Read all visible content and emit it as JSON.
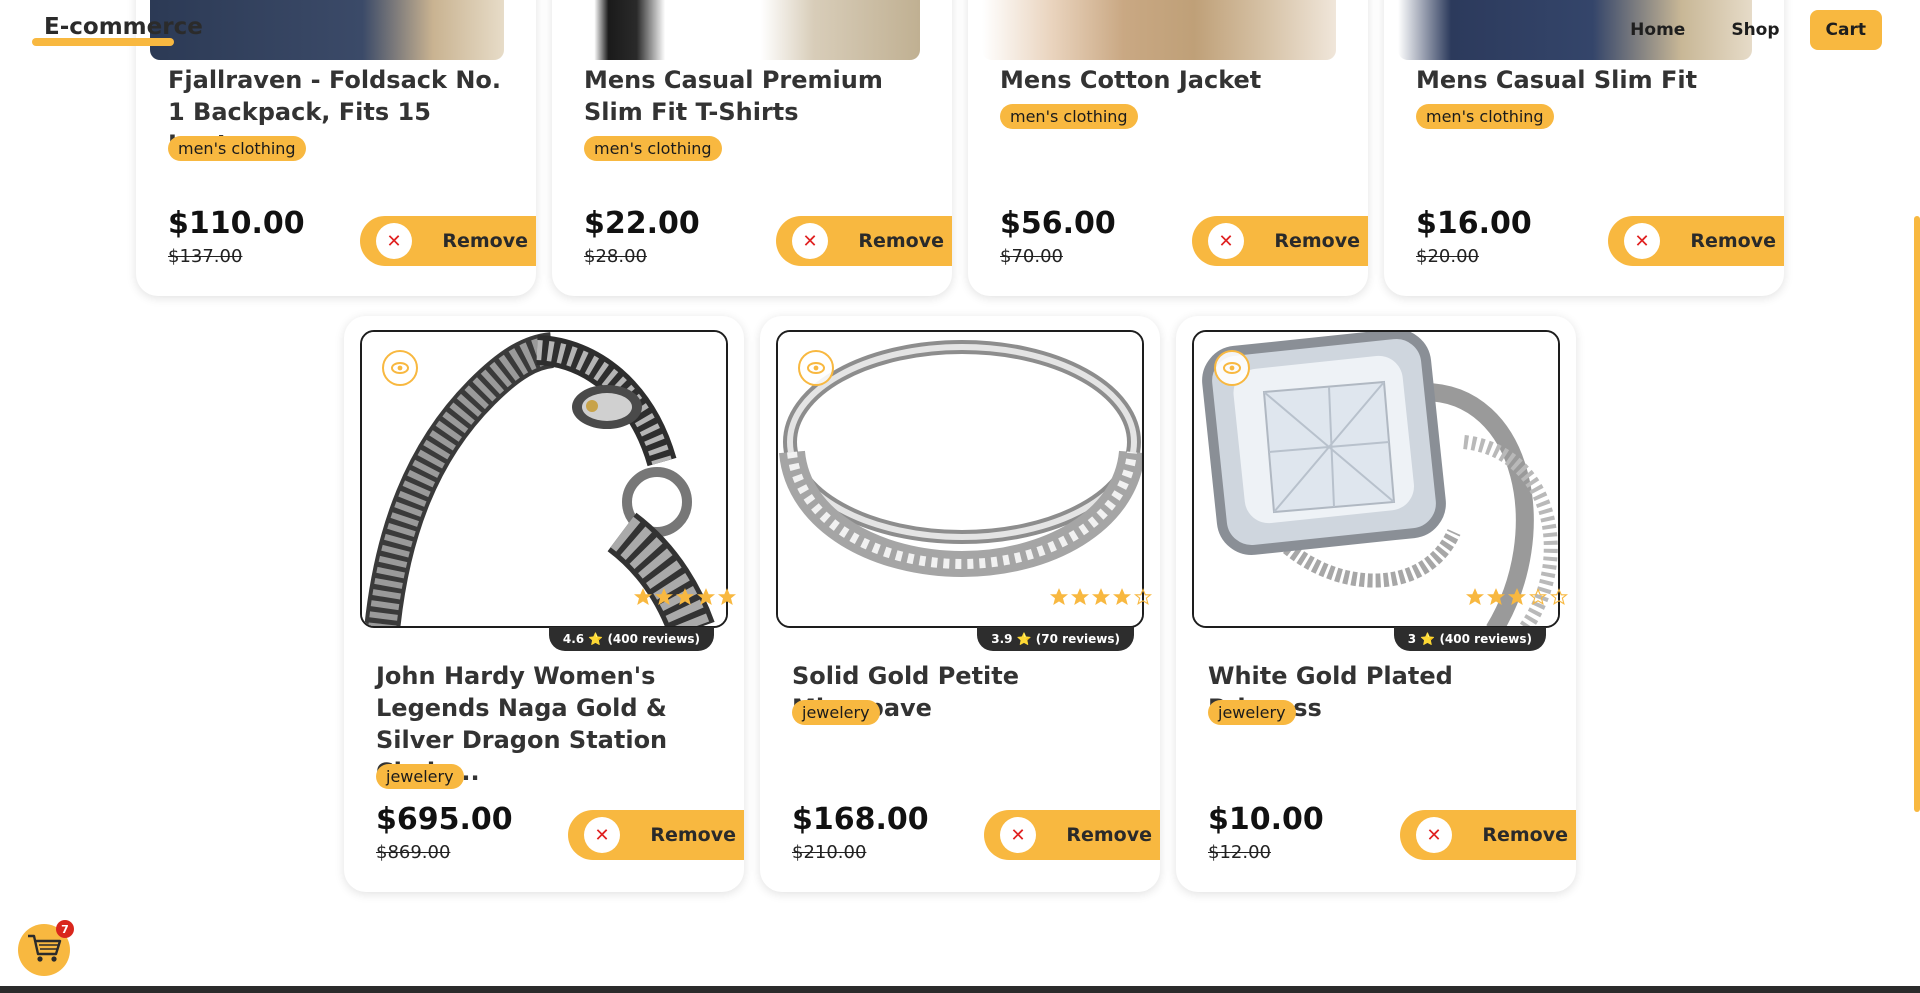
{
  "header": {
    "logo": "E-commerce",
    "nav": [
      {
        "label": "Home"
      },
      {
        "label": "Shop"
      },
      {
        "label": "Cart"
      }
    ]
  },
  "cart": {
    "count": "7"
  },
  "remove_label": "Remove",
  "top_products": [
    {
      "title": "Fjallraven - Foldsack No. 1 Backpack, Fits 15 Laptops",
      "category": "men's clothing",
      "price": "$110.00",
      "old_price": "$137.00"
    },
    {
      "title": "Mens Casual Premium Slim Fit T-Shirts",
      "category": "men's clothing",
      "price": "$22.00",
      "old_price": "$28.00"
    },
    {
      "title": "Mens Cotton Jacket",
      "category": "men's clothing",
      "price": "$56.00",
      "old_price": "$70.00"
    },
    {
      "title": "Mens Casual Slim Fit",
      "category": "men's clothing",
      "price": "$16.00",
      "old_price": "$20.00"
    }
  ],
  "bottom_products": [
    {
      "title": "John Hardy Women's Legends Naga Gold & Silver Dragon Station Chain...",
      "category": "jewelery",
      "price": "$695.00",
      "old_price": "$869.00",
      "rating": 4.6,
      "rating_label": "4.6 ⭐ (400 reviews)",
      "image": "dragon-bracelet"
    },
    {
      "title": "Solid Gold Petite Micropave",
      "category": "jewelery",
      "price": "$168.00",
      "old_price": "$210.00",
      "rating": 3.9,
      "rating_label": "3.9 ⭐ (70 reviews)",
      "image": "silver-ring"
    },
    {
      "title": "White Gold Plated Princess",
      "category": "jewelery",
      "price": "$10.00",
      "old_price": "$12.00",
      "rating": 3,
      "rating_label": "3 ⭐ (400 reviews)",
      "image": "princess-ring"
    }
  ],
  "colors": {
    "accent": "#f8b840",
    "remove_x": "#e02020",
    "badge": "#d9261c"
  }
}
